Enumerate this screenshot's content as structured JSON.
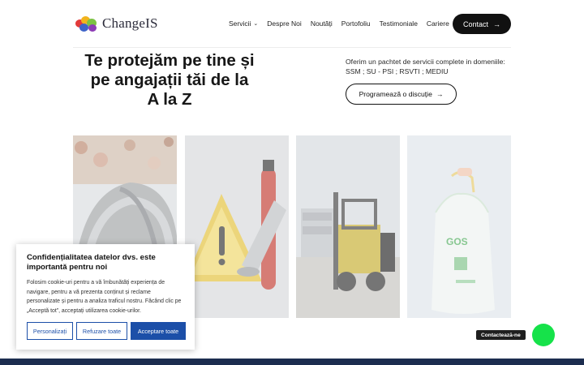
{
  "header": {
    "logo_text": "ChangeIS",
    "nav": [
      {
        "label": "Servicii",
        "has_dropdown": true
      },
      {
        "label": "Despre Noi"
      },
      {
        "label": "Noutăți"
      },
      {
        "label": "Portofoliu"
      },
      {
        "label": "Testimoniale"
      },
      {
        "label": "Cariere"
      }
    ],
    "contact_label": "Contact",
    "contact_icon": "arrow-right-icon"
  },
  "hero": {
    "title_line1": "Te protejăm pe tine și",
    "title_line2": "pe angajații tăi de la",
    "title_line3": "A la Z",
    "description": "Oferim un pachtet de servicii complete in domeniile: SSM ; SU - PSI ; RSVTI ; MEDIU",
    "cta_label": "Programează o discuție"
  },
  "cards": [
    {
      "icon": "hard-hat-image"
    },
    {
      "icon": "warning-sign-megaphone-image"
    },
    {
      "icon": "forklift-image"
    },
    {
      "icon": "waste-bag-image"
    }
  ],
  "cookie": {
    "title": "Confidențialitatea datelor dvs. este importantă pentru noi",
    "text": "Folosim cookie-uri pentru a vă îmbunătăți experiența de navigare, pentru a vă prezenta conținut și reclame personalizate și pentru a analiza traficul nostru. Făcând clic pe „Acceptă tot”, acceptați utilizarea cookie-urilor.",
    "customize_label": "Personalizați",
    "reject_label": "Refuzare toate",
    "accept_label": "Acceptare toate"
  },
  "chat": {
    "label": "Contactează-ne",
    "color": "#16e24a"
  },
  "colors": {
    "accent_blue": "#1c4fa8",
    "dark": "#111111",
    "footer": "#1c2d4f"
  }
}
